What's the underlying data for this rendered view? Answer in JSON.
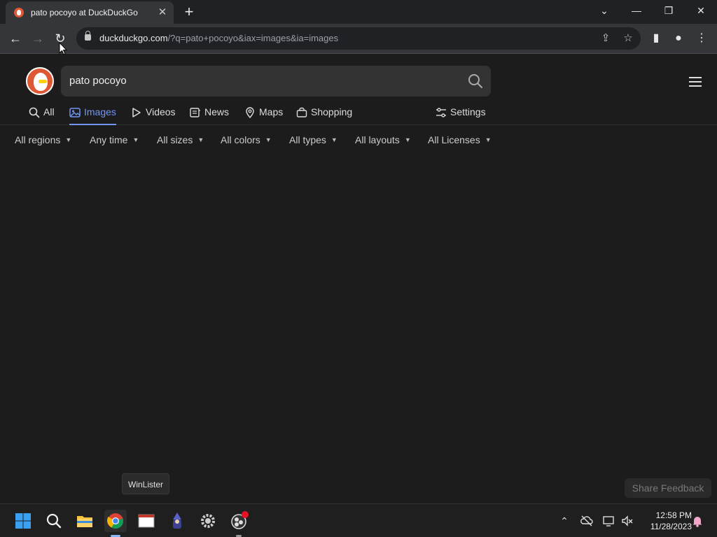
{
  "browser": {
    "tab_title": "pato pocoyo at DuckDuckGo",
    "url_domain": "duckduckgo.com",
    "url_path": "/?q=pato+pocoyo&iax=images&ia=images"
  },
  "search": {
    "query": "pato pocoyo"
  },
  "nav_tabs": [
    {
      "label": "All",
      "icon": "search-icon"
    },
    {
      "label": "Images",
      "icon": "image-icon",
      "active": true
    },
    {
      "label": "Videos",
      "icon": "play-icon"
    },
    {
      "label": "News",
      "icon": "newspaper-icon"
    },
    {
      "label": "Maps",
      "icon": "map-pin-icon"
    },
    {
      "label": "Shopping",
      "icon": "shopping-bag-icon"
    }
  ],
  "settings_label": "Settings",
  "filters": [
    "All regions",
    "Any time",
    "All sizes",
    "All colors",
    "All types",
    "All layouts",
    "All Licenses"
  ],
  "tooltip": "WinLister",
  "feedback_label": "Share Feedback",
  "clock": {
    "time": "12:58 PM",
    "date": "11/28/2023"
  },
  "colors": {
    "accent": "#7295f6",
    "ddg_orange": "#de5833",
    "page_bg": "#1c1c1c"
  }
}
